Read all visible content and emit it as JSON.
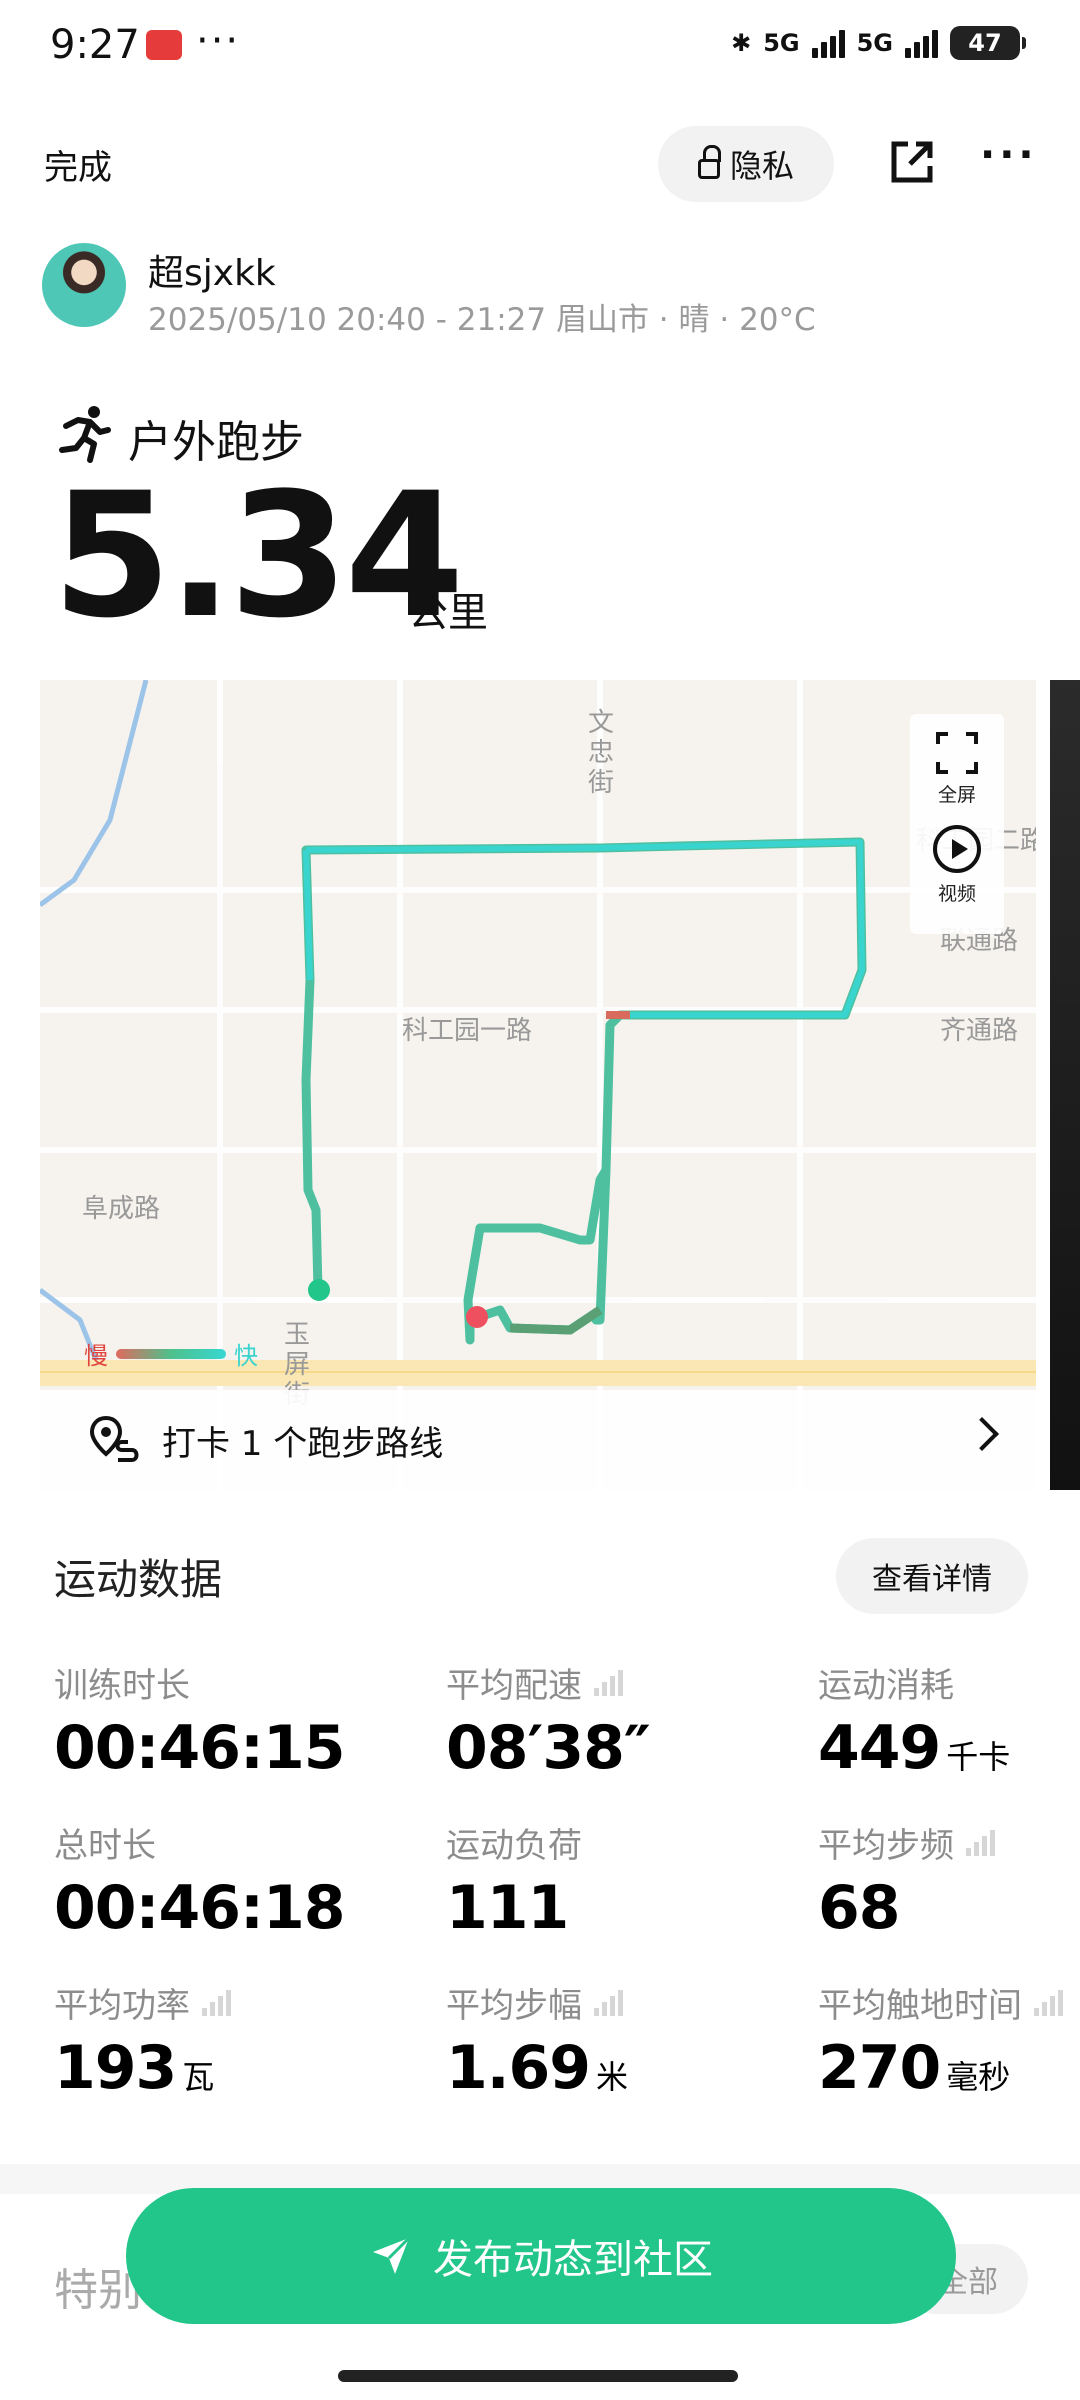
{
  "status_bar": {
    "time": "9:27",
    "dots": "···",
    "net1": "5G",
    "net2": "5G",
    "battery": "47"
  },
  "header": {
    "done_label": "完成",
    "privacy_label": "隐私",
    "more_label": "···"
  },
  "user": {
    "name": "超sjxkk",
    "meta": "2025/05/10 20:40 - 21:27 眉山市 · 晴 · 20°C"
  },
  "activity": {
    "sport": "户外跑步",
    "distance": "5.34",
    "distance_unit": "公里"
  },
  "map": {
    "road_labels": [
      "文忠街",
      "科工园一路",
      "阜成路",
      "联通路",
      "齐通路",
      "玉屏街",
      "科工园二路"
    ],
    "controls": {
      "fullscreen": "全屏",
      "video": "视频"
    },
    "legend": {
      "slow": "慢",
      "fast": "快"
    },
    "checkin": "打卡 1 个跑步路线"
  },
  "stats": {
    "title": "运动数据",
    "detail_label": "查看详情",
    "items": [
      {
        "label": "训练时长",
        "value": "00:46:15",
        "unit": ""
      },
      {
        "label": "平均配速",
        "value": "08′38″",
        "unit": ""
      },
      {
        "label": "运动消耗",
        "value": "449",
        "unit": "千卡"
      },
      {
        "label": "总时长",
        "value": "00:46:18",
        "unit": ""
      },
      {
        "label": "运动负荷",
        "value": "111",
        "unit": ""
      },
      {
        "label": "平均步频",
        "value": "68",
        "unit": ""
      },
      {
        "label": "平均功率",
        "value": "193",
        "unit": "瓦"
      },
      {
        "label": "平均步幅",
        "value": "1.69",
        "unit": "米"
      },
      {
        "label": "平均触地时间",
        "value": "270",
        "unit": "毫秒"
      }
    ]
  },
  "bottom": {
    "special_label": "特别",
    "all_label": "全部",
    "publish_label": "发布动态到社区"
  },
  "colors": {
    "accent": "#22c58a",
    "route": "#3ad4cf",
    "route_slow": "#e0443e"
  }
}
